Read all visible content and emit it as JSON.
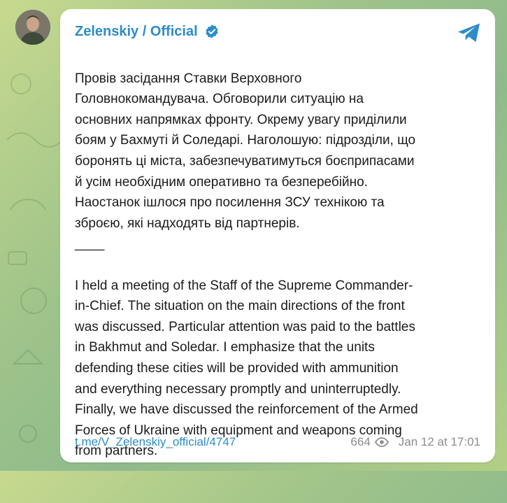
{
  "post": {
    "channel": "Zelenskiy / Official",
    "verified_icon": "verified-badge-icon",
    "share_icon": "telegram-plane-icon",
    "text_uk_lines": [
      "Провів засідання Ставки Верховного",
      "Головнокомандувача. Обговорили ситуацію на",
      "основних напрямках фронту. Окрему увагу приділили",
      "боям у Бахмуті й Соледарі. Наголошую: підрозділи, що",
      "боронять ці міста, забезпечуватимуться боєприпасами",
      "й усім необхідним оперативно та безперебійно.",
      "Наостанок ішлося про посилення ЗСУ технікою та",
      "зброєю, які надходять від партнерів."
    ],
    "separator": "____",
    "text_en_lines": [
      "I held a meeting of the Staff of the Supreme Commander-",
      "in-Chief. The situation on the main directions of the front",
      "was discussed. Particular attention was paid to the battles",
      "in Bakhmut and Soledar. I emphasize that the units",
      "defending these cities will be provided with ammunition",
      "and everything necessary promptly and uninterruptedly.",
      "Finally, we have discussed the reinforcement of the Armed",
      "Forces of Ukraine with equipment and weapons coming",
      "from partners."
    ],
    "link": "t.me/V_Zelenskiy_official/4747",
    "views": "664",
    "date": "Jan 12 at 17:01"
  },
  "colors": {
    "accent": "#2d8cc9",
    "meta": "#8c8c8c",
    "bubble": "#ffffff"
  }
}
